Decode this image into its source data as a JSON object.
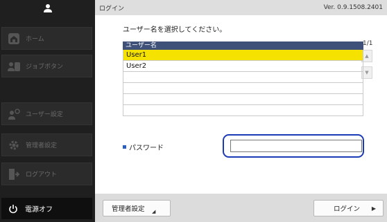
{
  "sidebar": {
    "items": [
      {
        "label": "ホーム",
        "icon": "home-icon"
      },
      {
        "label": "ジョブボタン",
        "icon": "job-button-icon"
      },
      {
        "label": "ユーザー設定",
        "icon": "user-settings-icon"
      },
      {
        "label": "管理者設定",
        "icon": "gear-icon"
      },
      {
        "label": "ログアウト",
        "icon": "logout-icon"
      }
    ],
    "power_label": "電源オフ"
  },
  "header": {
    "title": "ログイン",
    "version": "Ver. 0.9.1508.2401"
  },
  "main": {
    "instruction": "ユーザー名を選択してください。",
    "pager": "1/1",
    "table": {
      "column_header": "ユーザー名",
      "rows": [
        "User1",
        "User2",
        "",
        "",
        "",
        ""
      ],
      "selected_index": 0
    },
    "password_label": "パスワード",
    "password_value": ""
  },
  "footer": {
    "admin_button": "管理者設定",
    "login_button": "ログイン"
  },
  "colors": {
    "selected_row": "#f6e200",
    "table_header": "#3f5178",
    "focus_outline": "#1b3ab5",
    "sidebar_bg": "#1f1f1f"
  }
}
